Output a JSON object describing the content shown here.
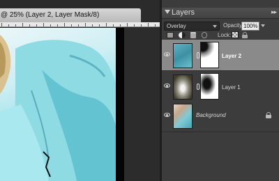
{
  "document": {
    "tab_title": "@ 25% (Layer 2, Layer Mask/8)"
  },
  "layers_panel": {
    "title": "Layers",
    "collapse_icon": "triangle-down-icon",
    "menu_icon": "panel-menu-icon",
    "blend_mode": "Overlay",
    "opacity_label": "Opacity:",
    "opacity_value": "100%",
    "lock_label": "Lock:",
    "tool_icons": [
      "new-layer-icon",
      "adjustment-layer-icon",
      "trash-icon",
      "link-layers-icon"
    ],
    "layers": [
      {
        "name": "Layer 2",
        "selected": true,
        "visible": true,
        "has_mask": true
      },
      {
        "name": "Layer 1",
        "selected": false,
        "visible": true,
        "has_mask": true
      },
      {
        "name": "Background",
        "selected": false,
        "visible": true,
        "locked": true
      }
    ]
  },
  "colors": {
    "selected_row": "#8a8a8a",
    "panel_bg": "#3c3c3c",
    "photo_accent": "#7ad2dd"
  }
}
